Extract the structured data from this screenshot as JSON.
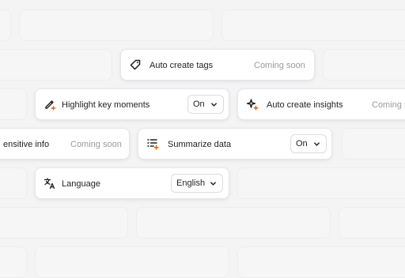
{
  "features": {
    "auto_create_tags": {
      "label": "Auto create tags",
      "status": "Coming soon",
      "icon": "tag-icon"
    },
    "highlight_key_moments": {
      "label": "Highlight key moments",
      "value": "On",
      "icon": "highlight-pen-icon"
    },
    "auto_create_insights": {
      "label": "Auto create insights",
      "status": "Coming soon",
      "icon": "sparkle-icon"
    },
    "sensitive_info": {
      "label": "ensitive info",
      "status": "Coming soon"
    },
    "summarize_data": {
      "label": "Summarize data",
      "value": "On",
      "icon": "list-sparkle-icon"
    },
    "language": {
      "label": "Language",
      "value": "English",
      "icon": "translate-icon"
    }
  },
  "colors": {
    "accent": "#e8590c",
    "text": "#1f1f22",
    "muted": "#9a9aa0",
    "card": "#ffffff",
    "background": "#f4f4f5"
  }
}
